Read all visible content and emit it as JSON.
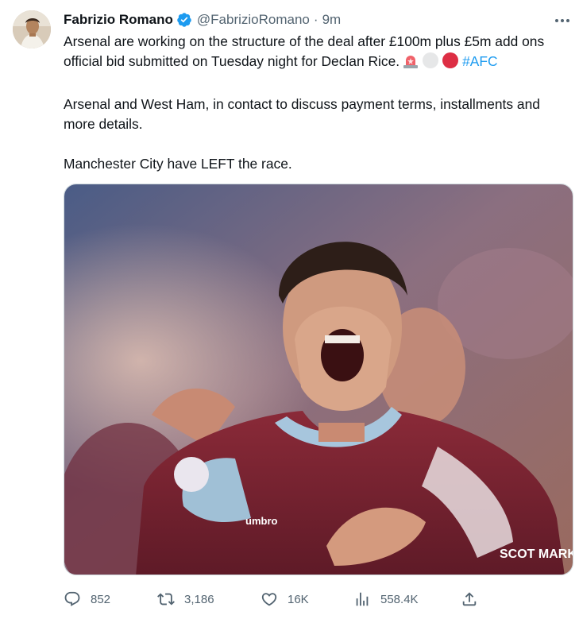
{
  "author": {
    "name": "Fabrizio Romano",
    "handle": "@FabrizioRomano",
    "separator": "·",
    "time": "9m"
  },
  "tweet": {
    "paragraph1": "Arsenal are working on the structure of the deal after £100m plus £5m add ons official bid submitted on Tuesday night for Declan Rice.",
    "hashtag": "#AFC",
    "paragraph2": "Arsenal and West Ham, in contact to discuss payment terms, installments and more details.",
    "paragraph3": "Manchester City have LEFT the race."
  },
  "media": {
    "description": "Photo of footballer in claret West Ham kit shouting in celebration",
    "kit_text": "umbro",
    "sponsor_text": "SCOT MARKE"
  },
  "metrics": {
    "replies": "852",
    "retweets": "3,186",
    "likes": "16K",
    "views": "558.4K"
  },
  "icons": {
    "verified": "verified-badge-icon",
    "more": "more-options-icon",
    "emojis": [
      "police-light-icon",
      "white-circle-icon",
      "red-circle-icon"
    ],
    "reply": "reply-icon",
    "retweet": "retweet-icon",
    "like": "heart-icon",
    "views": "views-icon",
    "share": "share-icon"
  },
  "colors": {
    "accent": "#1d9bf0",
    "text": "#0f1419",
    "muted": "#536471",
    "kit": "#7a2432"
  }
}
